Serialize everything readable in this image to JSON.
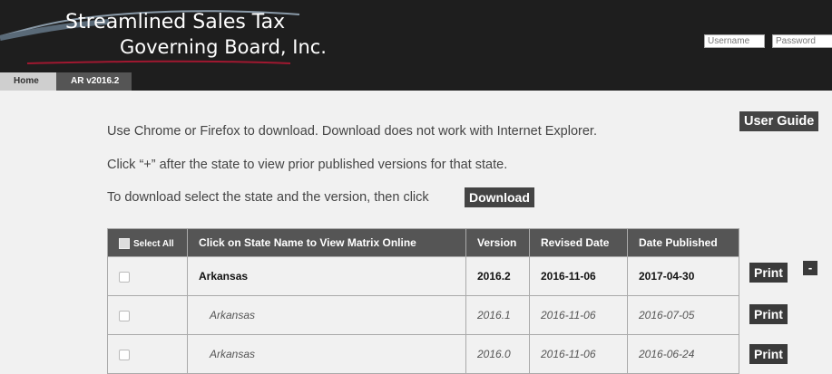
{
  "header": {
    "logo_line1": "Streamlined Sales Tax",
    "logo_line2": "Governing Board, Inc.",
    "username_placeholder": "Username",
    "password_placeholder": "Password"
  },
  "tabs": [
    {
      "label": "Home"
    },
    {
      "label": "AR v2016.2"
    }
  ],
  "instructions": {
    "line1": "Use Chrome or Firefox to download. Download does not work with Internet Explorer.",
    "line2": "Click “+” after the state to view prior published versions for that state.",
    "line3": "To download select the state and the version, then click",
    "download_label": "Download",
    "user_guide_label": "User Guide"
  },
  "table": {
    "headers": {
      "select_all": "Select All",
      "state": "Click on State Name to View Matrix Online",
      "version": "Version",
      "revised": "Revised Date",
      "published": "Date Published"
    },
    "rows": [
      {
        "state": "Arkansas",
        "version": "2016.2",
        "revised": "2016-11-06",
        "published": "2017-04-30",
        "print": "Print",
        "toggle": "-"
      },
      {
        "state": "Arkansas",
        "version": "2016.1",
        "revised": "2016-11-06",
        "published": "2016-07-05",
        "print": "Print"
      },
      {
        "state": "Arkansas",
        "version": "2016.0",
        "revised": "2016-11-06",
        "published": "2016-06-24",
        "print": "Print"
      }
    ]
  }
}
